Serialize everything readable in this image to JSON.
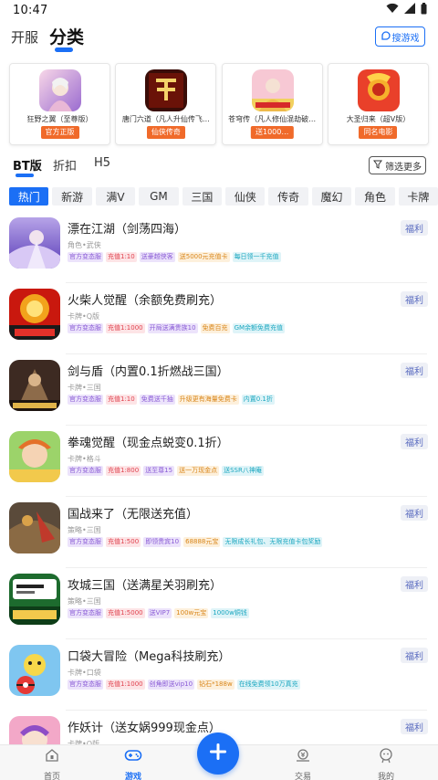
{
  "status_bar": {
    "time": "10:47"
  },
  "top_tabs": {
    "kaifu": "开服",
    "fenlei": "分类"
  },
  "search_button": "搜游戏",
  "featured": [
    {
      "title": "狂野之翼（至尊版）",
      "badge": "官方正版"
    },
    {
      "title": "唐门六道（凡人升仙传飞…",
      "badge": "仙侠传奇"
    },
    {
      "title": "苍穹传（凡人修仙混劫破…",
      "badge": "送1000…"
    },
    {
      "title": "大圣归来（超V版）",
      "badge": "同名电影"
    }
  ],
  "sub_tabs": {
    "bt": "BT版",
    "zhekou": "折扣",
    "h5": "H5"
  },
  "filter_button": "筛选更多",
  "categories": [
    "热门",
    "新游",
    "满V",
    "GM",
    "三国",
    "仙侠",
    "传奇",
    "魔幻",
    "角色",
    "卡牌"
  ],
  "welfare_label": "福利",
  "games": [
    {
      "name": "漂在江湖（剑荡四海）",
      "category": "角色•武侠",
      "tags": [
        {
          "text": "官方变态服",
          "color": "#8a5cd6",
          "bg": "#ece3fb"
        },
        {
          "text": "充值1:10",
          "color": "#e0434f",
          "bg": "#fde4e6"
        },
        {
          "text": "送豪越侠客",
          "color": "#8a5cd6",
          "bg": "#ece3fb"
        },
        {
          "text": "送5000元充值卡",
          "color": "#d9861a",
          "bg": "#fdf0dc"
        },
        {
          "text": "每日领一千充值",
          "color": "#1ca7c0",
          "bg": "#dff4f8"
        }
      ]
    },
    {
      "name": "火柴人觉醒（余额免费刷充）",
      "category": "卡牌•Q版",
      "tags": [
        {
          "text": "官方变态服",
          "color": "#8a5cd6",
          "bg": "#ece3fb"
        },
        {
          "text": "充值1:1000",
          "color": "#e0434f",
          "bg": "#fde4e6"
        },
        {
          "text": "开局送满贵族10",
          "color": "#8a5cd6",
          "bg": "#ece3fb"
        },
        {
          "text": "免费百充",
          "color": "#d9861a",
          "bg": "#fdf0dc"
        },
        {
          "text": "GM余额免费充值",
          "color": "#1ca7c0",
          "bg": "#dff4f8"
        }
      ]
    },
    {
      "name": "剑与盾（内置0.1折燃战三国）",
      "category": "卡牌•三国",
      "tags": [
        {
          "text": "官方变态服",
          "color": "#8a5cd6",
          "bg": "#ece3fb"
        },
        {
          "text": "充值1:10",
          "color": "#e0434f",
          "bg": "#fde4e6"
        },
        {
          "text": "免费送千抽",
          "color": "#8a5cd6",
          "bg": "#ece3fb"
        },
        {
          "text": "升级更有海量免费卡",
          "color": "#d9861a",
          "bg": "#fdf0dc"
        },
        {
          "text": "内置0.1折",
          "color": "#1ca7c0",
          "bg": "#dff4f8"
        }
      ]
    },
    {
      "name": "拳魂觉醒（现金点蜕变0.1折）",
      "category": "卡牌•格斗",
      "tags": [
        {
          "text": "官方变态服",
          "color": "#8a5cd6",
          "bg": "#ece3fb"
        },
        {
          "text": "充值1:800",
          "color": "#e0434f",
          "bg": "#fde4e6"
        },
        {
          "text": "送至尊15",
          "color": "#8a5cd6",
          "bg": "#ece3fb"
        },
        {
          "text": "送一万现金点",
          "color": "#d9861a",
          "bg": "#fdf0dc"
        },
        {
          "text": "送SSR八神庵",
          "color": "#1ca7c0",
          "bg": "#dff4f8"
        }
      ]
    },
    {
      "name": "国战来了（无限送充值）",
      "category": "策略•三国",
      "tags": [
        {
          "text": "官方变态服",
          "color": "#8a5cd6",
          "bg": "#ece3fb"
        },
        {
          "text": "充值1:500",
          "color": "#e0434f",
          "bg": "#fde4e6"
        },
        {
          "text": "即领贵宾10",
          "color": "#8a5cd6",
          "bg": "#ece3fb"
        },
        {
          "text": "68888元宝",
          "color": "#d9861a",
          "bg": "#fdf0dc"
        },
        {
          "text": "无限成长礼包、无限充值卡包奖励",
          "color": "#1ca7c0",
          "bg": "#dff4f8"
        }
      ]
    },
    {
      "name": "攻城三国（送满星关羽刷充）",
      "category": "策略•三国",
      "tags": [
        {
          "text": "官方变态服",
          "color": "#8a5cd6",
          "bg": "#ece3fb"
        },
        {
          "text": "充值1:5000",
          "color": "#e0434f",
          "bg": "#fde4e6"
        },
        {
          "text": "送VIP7",
          "color": "#8a5cd6",
          "bg": "#ece3fb"
        },
        {
          "text": "100w元宝",
          "color": "#d9861a",
          "bg": "#fdf0dc"
        },
        {
          "text": "1000w铜钱",
          "color": "#1ca7c0",
          "bg": "#dff4f8"
        }
      ]
    },
    {
      "name": "口袋大冒险（Mega科技刷充）",
      "category": "卡牌•口袋",
      "tags": [
        {
          "text": "官方变态服",
          "color": "#8a5cd6",
          "bg": "#ece3fb"
        },
        {
          "text": "充值1:1000",
          "color": "#e0434f",
          "bg": "#fde4e6"
        },
        {
          "text": "创角即送vip10",
          "color": "#8a5cd6",
          "bg": "#ece3fb"
        },
        {
          "text": "钻石*188w",
          "color": "#d9861a",
          "bg": "#fdf0dc"
        },
        {
          "text": "在线免费领10万真充",
          "color": "#1ca7c0",
          "bg": "#dff4f8"
        }
      ]
    },
    {
      "name": "作妖计（送女娲999现金点）",
      "category": "卡牌•Q版",
      "tags": []
    }
  ],
  "bottom_nav": [
    "首页",
    "游戏",
    "交易",
    "我的"
  ],
  "colors": {
    "accent": "#1b6ff5",
    "badge": "#f06a2a"
  }
}
